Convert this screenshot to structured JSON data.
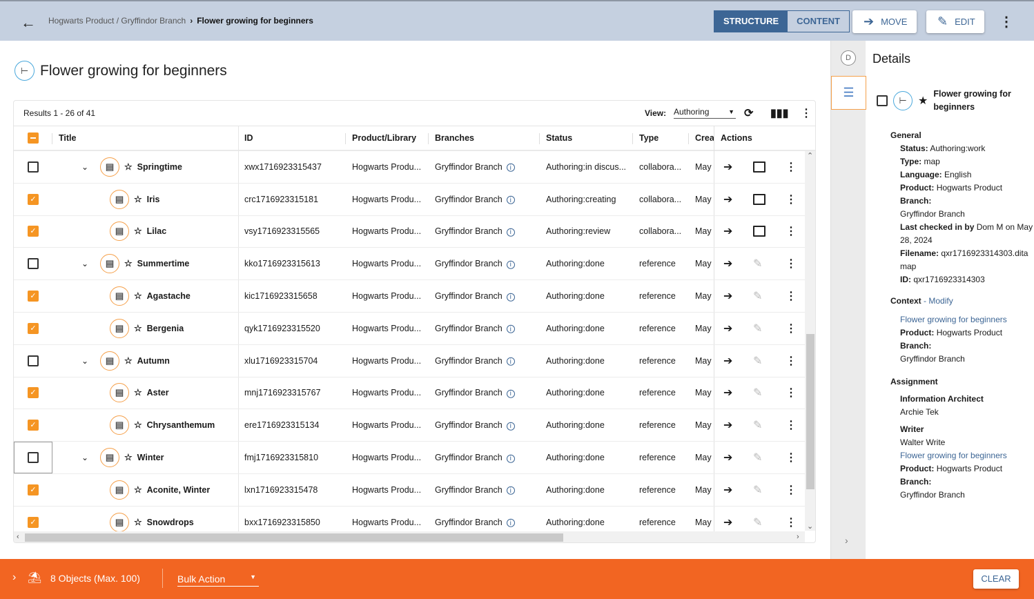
{
  "header": {
    "breadcrumb_parent": "Hogwarts Product / Gryffindor Branch",
    "breadcrumb_current": "Flower growing for beginners",
    "tabs": [
      "STRUCTURE",
      "CONTENT"
    ],
    "move_label": "MOVE",
    "edit_label": "EDIT"
  },
  "page": {
    "title": "Flower growing for beginners"
  },
  "grid": {
    "results": "Results 1 - 26 of 41",
    "view_label": "View:",
    "view_value": "Authoring",
    "columns": [
      "Title",
      "ID",
      "Product/Library",
      "Branches",
      "Status",
      "Type",
      "Crea",
      "Actions"
    ],
    "rows": [
      {
        "title": "Springtime",
        "id": "xwx1716923315437",
        "product": "Hogwarts Produ...",
        "branch": "Gryffindor Branch",
        "status": "Authoring:in discus...",
        "type": "collabora...",
        "created": "May",
        "checked": false,
        "parent": true,
        "comment": true
      },
      {
        "title": "Iris",
        "id": "crc1716923315181",
        "product": "Hogwarts Produ...",
        "branch": "Gryffindor Branch",
        "status": "Authoring:creating",
        "type": "collabora...",
        "created": "May",
        "checked": true,
        "parent": false,
        "comment": true
      },
      {
        "title": "Lilac",
        "id": "vsy1716923315565",
        "product": "Hogwarts Produ...",
        "branch": "Gryffindor Branch",
        "status": "Authoring:review",
        "type": "collabora...",
        "created": "May",
        "checked": true,
        "parent": false,
        "comment": true
      },
      {
        "title": "Summertime",
        "id": "kko1716923315613",
        "product": "Hogwarts Produ...",
        "branch": "Gryffindor Branch",
        "status": "Authoring:done",
        "type": "reference",
        "created": "May",
        "checked": false,
        "parent": true,
        "comment": false
      },
      {
        "title": "Agastache",
        "id": "kic1716923315658",
        "product": "Hogwarts Produ...",
        "branch": "Gryffindor Branch",
        "status": "Authoring:done",
        "type": "reference",
        "created": "May",
        "checked": true,
        "parent": false,
        "comment": false
      },
      {
        "title": "Bergenia",
        "id": "qyk1716923315520",
        "product": "Hogwarts Produ...",
        "branch": "Gryffindor Branch",
        "status": "Authoring:done",
        "type": "reference",
        "created": "May",
        "checked": true,
        "parent": false,
        "comment": false
      },
      {
        "title": "Autumn",
        "id": "xlu1716923315704",
        "product": "Hogwarts Produ...",
        "branch": "Gryffindor Branch",
        "status": "Authoring:done",
        "type": "reference",
        "created": "May",
        "checked": false,
        "parent": true,
        "comment": false
      },
      {
        "title": "Aster",
        "id": "mnj1716923315767",
        "product": "Hogwarts Produ...",
        "branch": "Gryffindor Branch",
        "status": "Authoring:done",
        "type": "reference",
        "created": "May",
        "checked": true,
        "parent": false,
        "comment": false
      },
      {
        "title": "Chrysanthemum",
        "id": "ere1716923315134",
        "product": "Hogwarts Produ...",
        "branch": "Gryffindor Branch",
        "status": "Authoring:done",
        "type": "reference",
        "created": "May",
        "checked": true,
        "parent": false,
        "comment": false
      },
      {
        "title": "Winter",
        "id": "fmj1716923315810",
        "product": "Hogwarts Produ...",
        "branch": "Gryffindor Branch",
        "status": "Authoring:done",
        "type": "reference",
        "created": "May",
        "checked": false,
        "parent": true,
        "comment": false
      },
      {
        "title": "Aconite, Winter",
        "id": "lxn1716923315478",
        "product": "Hogwarts Produ...",
        "branch": "Gryffindor Branch",
        "status": "Authoring:done",
        "type": "reference",
        "created": "May",
        "checked": true,
        "parent": false,
        "comment": false
      },
      {
        "title": "Snowdrops",
        "id": "bxx1716923315850",
        "product": "Hogwarts Produ...",
        "branch": "Gryffindor Branch",
        "status": "Authoring:done",
        "type": "reference",
        "created": "May",
        "checked": true,
        "parent": false,
        "comment": false
      }
    ]
  },
  "details": {
    "heading": "Details",
    "rail_letter": "D",
    "title": "Flower growing for beginners",
    "general_label": "General",
    "status_k": "Status:",
    "status_v": "Authoring:work",
    "type_k": "Type:",
    "type_v": "map",
    "lang_k": "Language:",
    "lang_v": "English",
    "product_k": "Product:",
    "product_v": "Hogwarts Product",
    "branch_k": "Branch:",
    "branch_v": "Gryffindor Branch",
    "checked_k": "Last checked in by",
    "checked_v": "Dom M on May 28, 2024",
    "filename_k": "Filename:",
    "filename_v": "qxr1716923314303.ditamap",
    "id_k": "ID:",
    "id_v": "qxr1716923314303",
    "context_label": "Context",
    "context_modify": "- Modify",
    "context_link": "Flower growing for beginners",
    "assignment_label": "Assignment",
    "ia_role": "Information Architect",
    "ia_name": "Archie Tek",
    "writer_role": "Writer",
    "writer_name": "Walter Write",
    "writer_link": "Flower growing for beginners"
  },
  "bottom": {
    "objects": "8 Objects (Max. 100)",
    "bulk_action": "Bulk Action",
    "clear": "CLEAR"
  }
}
